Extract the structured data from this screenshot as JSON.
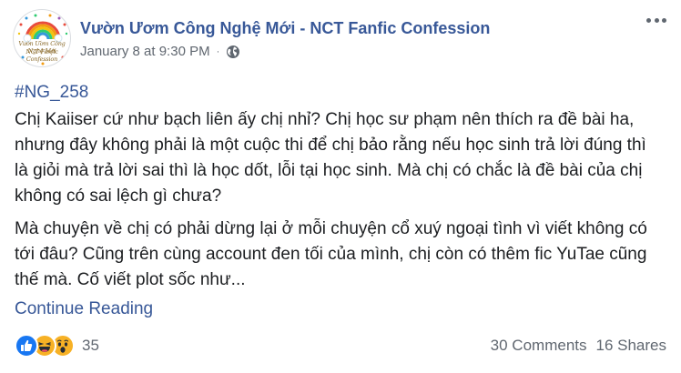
{
  "post": {
    "page_name": "Vườn Ươm Công Nghệ Mới - NCT Fanfic Confession",
    "timestamp": "January 8 at 9:30 PM",
    "separator": "·",
    "audience_icon": "globe-icon",
    "avatar_text_line1": "Vườn Ươm Công Nghệ Mới",
    "avatar_text_line2": "NCT Fanfic Confession"
  },
  "content": {
    "hashtag": "#NG_258",
    "paragraph1": "Chị Kaiiser cứ như bạch liên ấy chị nhỉ? Chị học sư phạm nên thích ra đề bài ha, nhưng đây không phải là một cuộc thi để chị bảo rằng nếu học sinh trả lời đúng thì là giỏi mà trả lời sai thì là học dốt, lỗi tại học sinh. Mà chị có chắc là đề bài của chị không có sai lệch gì chưa?",
    "paragraph2": "Mà chuyện về chị có phải dừng lại ở mỗi chuyện cổ xuý ngoại tình vì viết không có tới đâu? Cũng trên cùng account đen tối của mình, chị còn có thêm fic YuTae cũng thế mà. Cố viết plot sốc như...",
    "continue_label": "Continue Reading"
  },
  "footer": {
    "reactions": [
      "like-icon",
      "haha-icon",
      "wow-icon"
    ],
    "reaction_count": "35",
    "comments": "30 Comments",
    "shares": "16 Shares"
  },
  "colors": {
    "link": "#385898",
    "text": "#1c1e21",
    "muted": "#606770",
    "like": "#1877f2",
    "emoji": "#f7b125"
  }
}
